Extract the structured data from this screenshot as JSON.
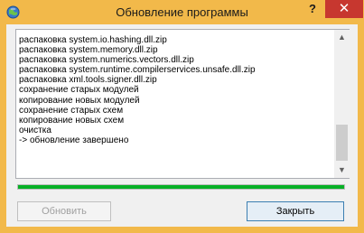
{
  "window": {
    "title": "Обновление программы",
    "help_glyph": "?",
    "close_glyph": "✕",
    "accent_color": "#f2b94a",
    "close_color": "#c7372f"
  },
  "log": {
    "lines": [
      "распаковка system.io.hashing.dll.zip",
      "распаковка system.memory.dll.zip",
      "распаковка system.numerics.vectors.dll.zip",
      "распаковка system.runtime.compilerservices.unsafe.dll.zip",
      "распаковка xml.tools.signer.dll.zip",
      "сохранение старых модулей",
      "копирование новых модулей",
      "сохранение старых схем",
      "копирование новых схем",
      "очистка",
      "-> обновление завершено"
    ],
    "scroll_up_glyph": "▲",
    "scroll_down_glyph": "▼"
  },
  "progress": {
    "value": 1.0,
    "color": "#06b025"
  },
  "buttons": {
    "update_label": "Обновить",
    "update_enabled": false,
    "close_label": "Закрыть"
  }
}
